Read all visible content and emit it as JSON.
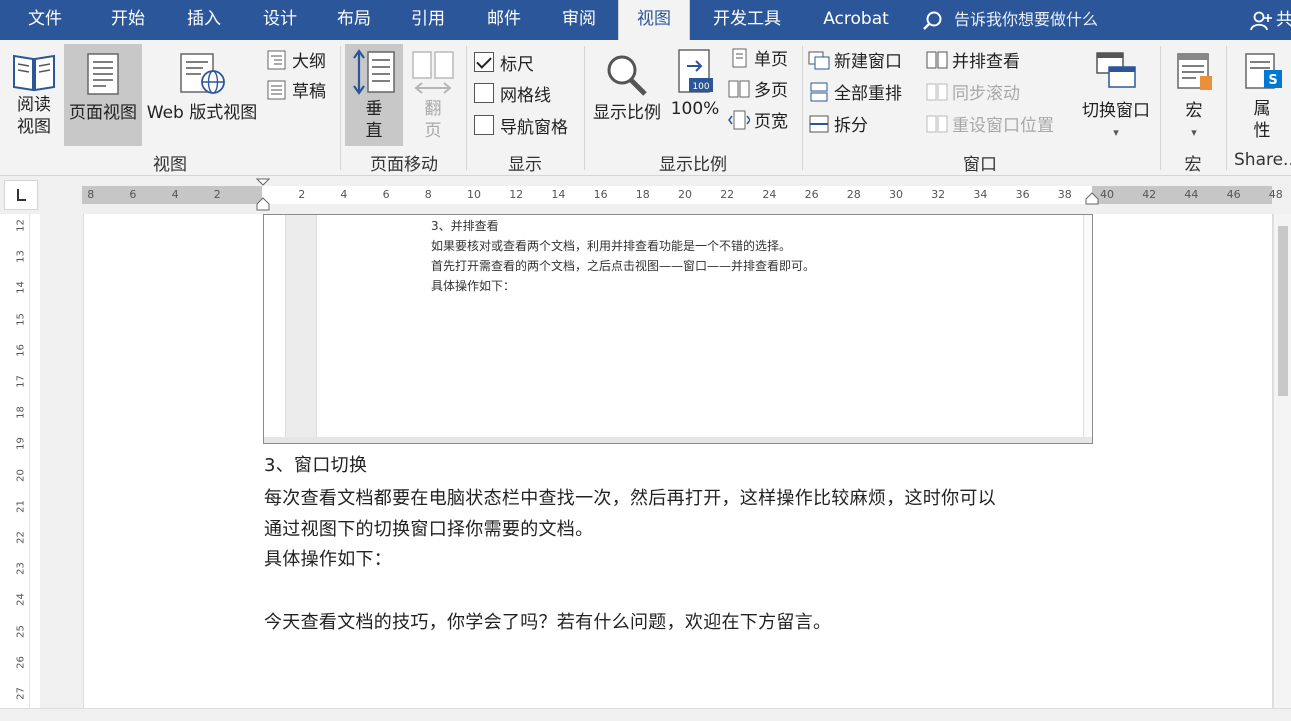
{
  "tabs": [
    {
      "label": "文件",
      "active": false
    },
    {
      "label": "开始",
      "active": false
    },
    {
      "label": "插入",
      "active": false
    },
    {
      "label": "设计",
      "active": false
    },
    {
      "label": "布局",
      "active": false
    },
    {
      "label": "引用",
      "active": false
    },
    {
      "label": "邮件",
      "active": false
    },
    {
      "label": "审阅",
      "active": false
    },
    {
      "label": "视图",
      "active": true
    },
    {
      "label": "开发工具",
      "active": false
    },
    {
      "label": "Acrobat",
      "active": false
    }
  ],
  "tellme": {
    "placeholder": "告诉我你想要做什么",
    "icon": "search-icon"
  },
  "share": {
    "label": "共",
    "icon": "person-add-icon"
  },
  "ribbon": {
    "view_group": {
      "label": "视图",
      "read_mode": {
        "line1": "阅读",
        "line2": "视图"
      },
      "print_layout": {
        "label": "页面视图",
        "selected": true
      },
      "web_layout": {
        "label": "Web 版式视图"
      },
      "outline": {
        "label": "大纲"
      },
      "draft": {
        "label": "草稿"
      }
    },
    "page_move_group": {
      "label": "页面移动",
      "vertical": {
        "line1": "垂",
        "line2": "直",
        "selected": true
      },
      "side_to_side": {
        "line1": "翻",
        "line2": "页",
        "disabled": true
      }
    },
    "show_group": {
      "label": "显示",
      "ruler": {
        "label": "标尺",
        "checked": true
      },
      "gridlines": {
        "label": "网格线",
        "checked": false
      },
      "nav_pane": {
        "label": "导航窗格",
        "checked": false
      }
    },
    "zoom_group": {
      "label": "显示比例",
      "zoom": {
        "label": "显示比例"
      },
      "hundred": {
        "label": "100%",
        "badge": "100"
      },
      "one_page": {
        "label": "单页"
      },
      "multi_page": {
        "label": "多页"
      },
      "page_width": {
        "label": "页宽"
      }
    },
    "window_group": {
      "label": "窗口",
      "new_window": {
        "label": "新建窗口"
      },
      "arrange_all": {
        "label": "全部重排"
      },
      "split": {
        "label": "拆分"
      },
      "side_by_side": {
        "label": "并排查看"
      },
      "sync_scroll": {
        "label": "同步滚动",
        "disabled": true
      },
      "reset_position": {
        "label": "重设窗口位置",
        "disabled": true
      },
      "switch_windows": {
        "label": "切换窗口"
      }
    },
    "macro_group": {
      "label": "宏",
      "macros": {
        "label": "宏"
      }
    },
    "share_group": {
      "label": "Share...",
      "properties": {
        "line1": "属",
        "line2": "性"
      }
    }
  },
  "ruler": {
    "ticks_left": [
      "8",
      "6",
      "4",
      "2"
    ],
    "ticks_main": [
      "2",
      "4",
      "6",
      "8",
      "10",
      "12",
      "14",
      "16",
      "18",
      "20",
      "22",
      "24",
      "26",
      "28",
      "30",
      "32",
      "34",
      "36",
      "38"
    ],
    "ticks_right": [
      "40",
      "42",
      "44",
      "46",
      "48"
    ],
    "vertical": [
      "12",
      "13",
      "14",
      "15",
      "16",
      "17",
      "18",
      "19",
      "20",
      "21",
      "22",
      "23",
      "24",
      "25",
      "26",
      "27"
    ]
  },
  "embedded": {
    "lines": [
      "3、并排查看",
      "如果要核对或查看两个文档，利用并排查看功能是一个不错的选择。",
      "首先打开需查看的两个文档，之后点击视图——窗口——并排查看即可。",
      "具体操作如下："
    ]
  },
  "document": {
    "heading": "3、窗口切换",
    "para1_line1": "每次查看文档都要在电脑状态栏中查找一次，然后再打开，这样操作比较麻烦，这时你可以",
    "para1_line2": "通过视图下的切换窗口择你需要的文档。",
    "para2": "具体操作如下：",
    "para3": "今天查看文档的技巧，你学会了吗？若有什么问题，欢迎在下方留言。"
  },
  "colors": {
    "accent": "#2b579a",
    "ribbon_bg": "#f3f3f3",
    "selected": "#c8c8c8"
  }
}
